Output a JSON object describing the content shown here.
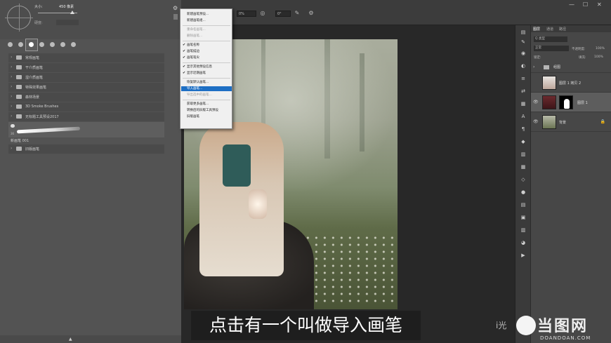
{
  "options_bar": {
    "percent": "0%",
    "angle": "0°",
    "window_controls": [
      "—",
      "☐",
      "✕"
    ]
  },
  "brush_panel": {
    "size_label": "大小:",
    "size_value": "450 像素",
    "hardness_label": "硬度:",
    "tips": [
      "",
      "",
      "",
      "",
      "",
      "",
      "",
      ""
    ],
    "tip_sizes": [
      "",
      "",
      "",
      "",
      "",
      "",
      "",
      ""
    ],
    "folders": [
      "常规画笔",
      "干介质画笔",
      "湿介质画笔",
      "特殊效果画笔",
      "森林场景",
      "3D Smoke Brushes",
      "无标题工具预设2017"
    ],
    "sample_number": "36",
    "sample_label": "新画笔 001",
    "last_folder": "旧版画笔"
  },
  "context_menu": {
    "items": [
      {
        "label": "新建画笔预设...",
        "checked": false,
        "disabled": false,
        "highlight": false
      },
      {
        "label": "新建画笔组...",
        "checked": false,
        "disabled": false,
        "highlight": false
      },
      {
        "label": "重命名画笔...",
        "checked": false,
        "disabled": true,
        "highlight": false
      },
      {
        "label": "删除画笔...",
        "checked": false,
        "disabled": true,
        "highlight": false
      },
      {
        "label": "画笔名称",
        "checked": true,
        "disabled": false,
        "highlight": false
      },
      {
        "label": "画笔描边",
        "checked": true,
        "disabled": false,
        "highlight": false
      },
      {
        "label": "画笔笔尖",
        "checked": true,
        "disabled": false,
        "highlight": false
      },
      {
        "label": "显示其他预设信息",
        "checked": true,
        "disabled": false,
        "highlight": false
      },
      {
        "label": "显示近期画笔",
        "checked": true,
        "disabled": false,
        "highlight": false
      },
      {
        "label": "恢复默认画笔...",
        "checked": false,
        "disabled": false,
        "highlight": false
      },
      {
        "label": "导入画笔...",
        "checked": false,
        "disabled": false,
        "highlight": true
      },
      {
        "label": "导出选中的画笔...",
        "checked": false,
        "disabled": true,
        "highlight": false
      },
      {
        "label": "获取更多画笔...",
        "checked": false,
        "disabled": false,
        "highlight": false
      },
      {
        "label": "转换后的旧版工具预设",
        "checked": false,
        "disabled": false,
        "highlight": false
      },
      {
        "label": "旧版画笔",
        "checked": false,
        "disabled": false,
        "highlight": false
      }
    ]
  },
  "layers_panel": {
    "tabs": [
      "图层",
      "通道",
      "路径"
    ],
    "kind_filter": "Q 类型",
    "blend_mode": "正常",
    "opacity_label": "不透明度:",
    "opacity_value": "100%",
    "lock_label": "锁定:",
    "fill_label": "填充:",
    "fill_value": "100%",
    "layers": [
      {
        "name": "组图",
        "type": "group"
      },
      {
        "name": "图层 1 拷贝 2",
        "type": "layer"
      },
      {
        "name": "图层 1",
        "type": "layer-mask",
        "selected": true
      },
      {
        "name": "背景",
        "type": "background"
      }
    ]
  },
  "subtitle": "点击有一个叫做导入画笔",
  "watermark": {
    "left_text": "i光",
    "brand": "当图网",
    "domain": "DOANDOAN.COM"
  },
  "colors": {
    "highlight": "#1e6fc4",
    "panel": "#535353",
    "canvas_bg": "#282828"
  }
}
